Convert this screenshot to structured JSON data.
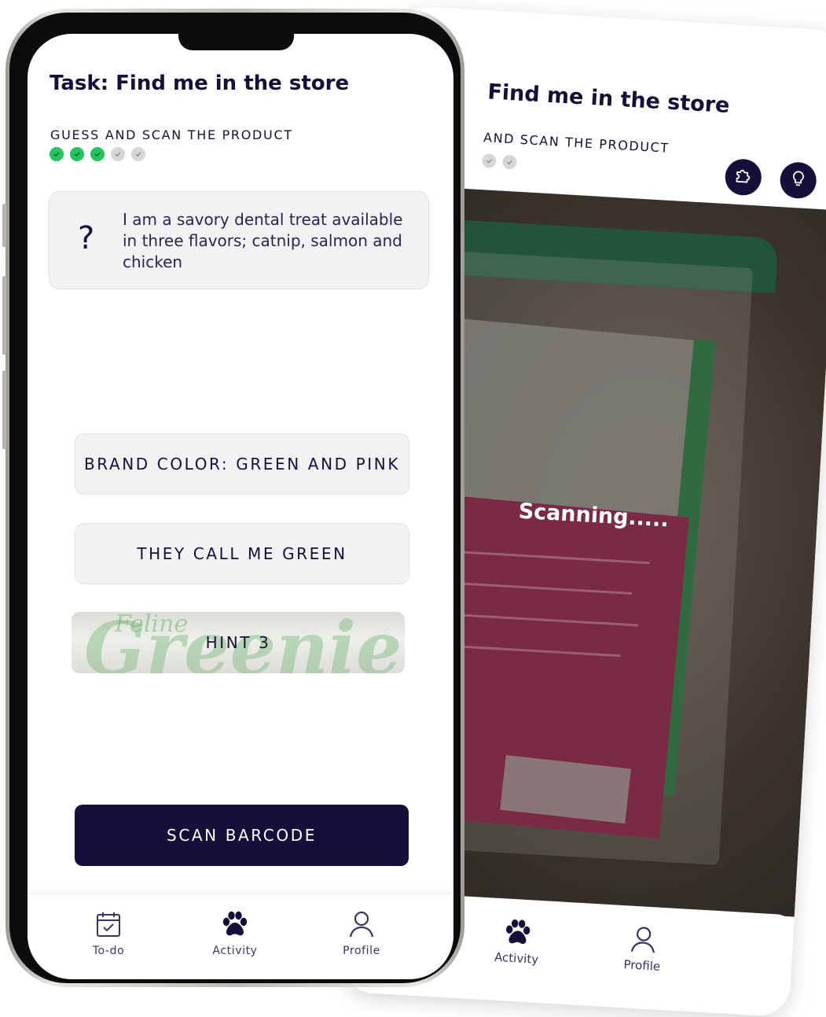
{
  "front": {
    "task_title": "Task: Find me in the store",
    "guess_label": "GUESS AND SCAN THE PRODUCT",
    "progress": {
      "completed": 3,
      "total": 5
    },
    "riddle_icon": "question-mark",
    "riddle_text": "I am a savory dental treat available in three flavors; catnip, salmon and chicken",
    "hints": [
      {
        "label": "BRAND COLOR: GREEN AND PINK"
      },
      {
        "label": "THEY CALL ME GREEN"
      },
      {
        "label": "HINT 3"
      }
    ],
    "scan_button": "SCAN BARCODE",
    "nav": [
      {
        "label": "To-do",
        "icon": "calendar-check-icon"
      },
      {
        "label": "Activity",
        "icon": "paw-icon"
      },
      {
        "label": "Profile",
        "icon": "user-icon"
      }
    ]
  },
  "back": {
    "title": "Find me in the store",
    "subtitle": "AND SCAN THE PRODUCT",
    "buttons": [
      {
        "icon": "puzzle-icon"
      },
      {
        "icon": "lightbulb-icon"
      }
    ],
    "scanning_text": "Scanning.....",
    "nav": [
      {
        "label": "Activity",
        "icon": "paw-icon"
      },
      {
        "label": "Profile",
        "icon": "user-icon"
      }
    ]
  },
  "colors": {
    "primary": "#15103a",
    "done_dot": "#22c55e",
    "todo_dot": "#d6d6d9",
    "card_bg": "#f2f2f5"
  }
}
